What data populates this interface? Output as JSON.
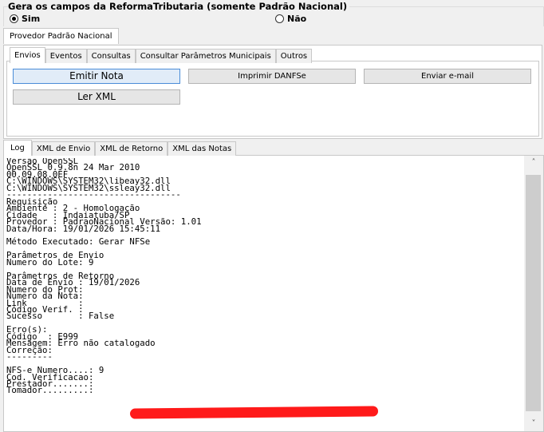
{
  "reforma_group": {
    "title": "Gera os campos da ReformaTributaria (somente Padrão Nacional)",
    "options": [
      {
        "label": "Sim",
        "selected": true
      },
      {
        "label": "Não",
        "selected": false
      }
    ]
  },
  "provider_tabs": [
    {
      "label": "Provedor Padrão Nacional",
      "active": true
    }
  ],
  "inner_tabs": [
    {
      "label": "Envios",
      "active": true
    },
    {
      "label": "Eventos",
      "active": false
    },
    {
      "label": "Consultas",
      "active": false
    },
    {
      "label": "Consultar Parâmetros Municipais",
      "active": false
    },
    {
      "label": "Outros",
      "active": false
    }
  ],
  "buttons": {
    "emitir_nota": "Emitir Nota",
    "imprimir_danfse": "Imprimir DANFSe",
    "enviar_email": "Enviar e-mail",
    "ler_xml": "Ler XML"
  },
  "log_tabs": [
    {
      "label": "Log",
      "active": true
    },
    {
      "label": "XML de Envio",
      "active": false
    },
    {
      "label": "XML de Retorno",
      "active": false
    },
    {
      "label": "XML das Notas",
      "active": false
    }
  ],
  "log_text": "Versão OpenSSL\nOpenSSL 0.9.8n 24 Mar 2010\n00.09.08.0EF\nC:\\WINDOWS\\SYSTEM32\\libeay32.dll\nC:\\WINDOWS\\SYSTEM32\\ssleay32.dll\n----------------------------------\nRequisição\nAmbiente : 2 - Homologação\nCidade   : Indaiatuba/SP\nProvedor : PadraoNacional Versão: 1.01\nData/Hora: 19/01/2026 15:45:11\n\nMétodo Executado: Gerar NFSe\n\nParâmetros de Envio\nNumero do Lote: 9\n\nParâmetros de Retorno\nData de Envio : 19/01/2026\nNumero do Prot:\nNumero da Nota:\nLink          :\nCódigo Verif. :\nSucesso       : False\n\nErro(s):\nCódigo  : E999\nMensagem: Erro não catalogado\nCorreção:\n---------\n\nNFS-e Numero....: 9\nCod. Verificacao:\nPrestador.......:\nTomador.........:",
  "icons": {
    "scroll_up": "chevron-up-icon",
    "scroll_down": "chevron-down-icon"
  },
  "colors": {
    "redaction": "#ff1a1a",
    "focus_border": "#4a8cd8"
  }
}
